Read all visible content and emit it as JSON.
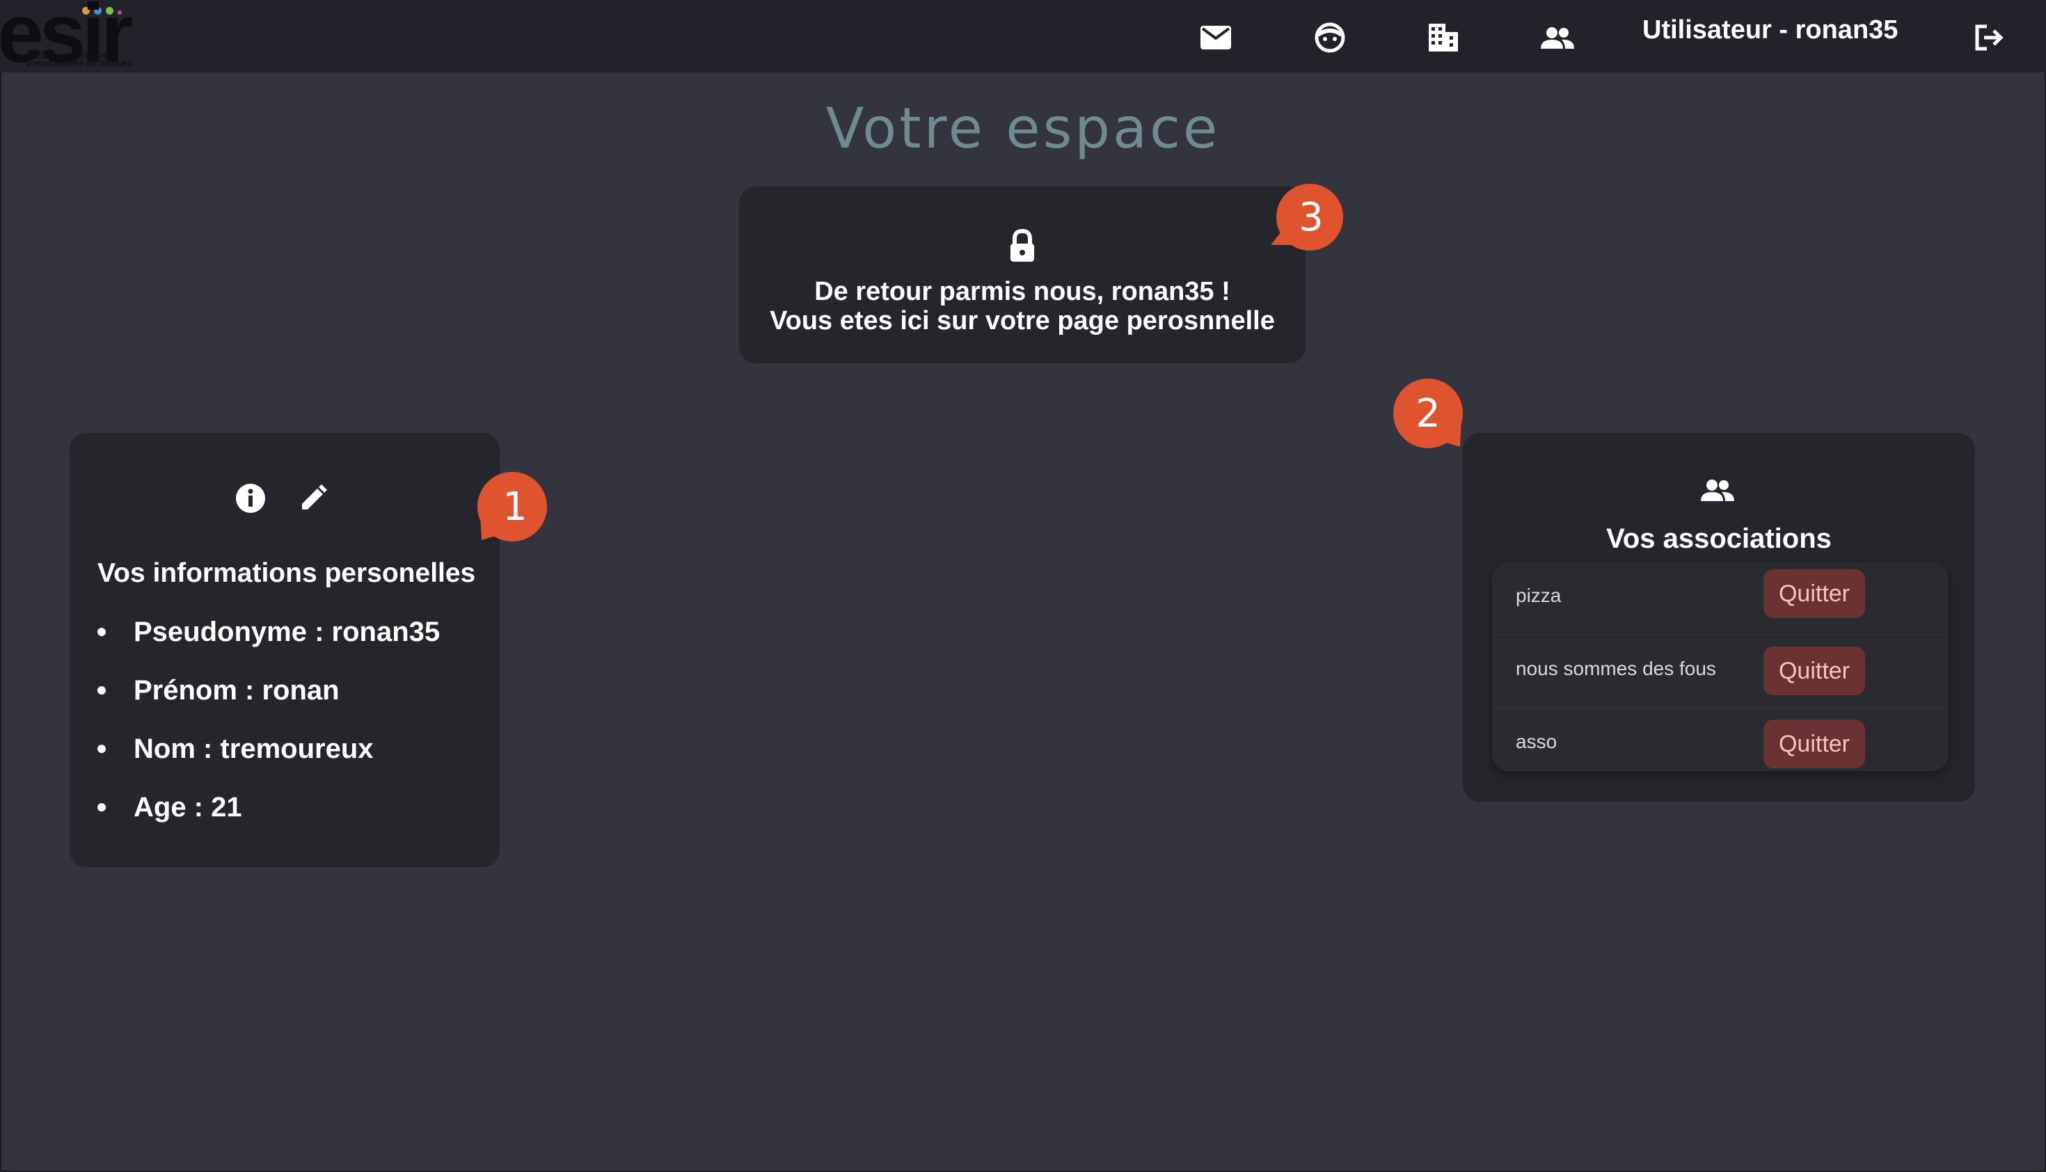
{
  "logo": {
    "text": "esir",
    "tagline": "ÉCOLE SUPÉRIEURE D'INGÉNIEURS DE RENNES",
    "dot_colors": [
      "#e29b3b",
      "#4a8fd6",
      "#7cc14a",
      "#c94c8f"
    ]
  },
  "topbar": {
    "icons": [
      "mail-icon",
      "face-icon",
      "building-icon",
      "group-icon",
      "logout-icon"
    ],
    "user_label": "Utilisateur - ronan35"
  },
  "page": {
    "title": "Votre espace"
  },
  "welcome": {
    "line1": "De retour parmis nous, ronan35 !",
    "line2": "Vous etes ici sur votre page perosnnelle"
  },
  "info": {
    "title": "Vos informations personelles",
    "items": [
      "Pseudonyme : ronan35",
      "Prénom : ronan",
      "Nom : tremoureux",
      "Age : 21"
    ]
  },
  "associations": {
    "title": "Vos associations",
    "rows": [
      {
        "name": "pizza",
        "action": "Quitter"
      },
      {
        "name": "nous sommes des fous",
        "action": "Quitter"
      },
      {
        "name": "asso",
        "action": "Quitter"
      }
    ]
  },
  "badges": [
    "1",
    "2",
    "3"
  ],
  "colors": {
    "background": "#34343f",
    "topbar": "#22222a",
    "card": "#25252c",
    "badge": "#e0532f",
    "quit_button": "#6a3232",
    "title": "#6f8a91"
  }
}
